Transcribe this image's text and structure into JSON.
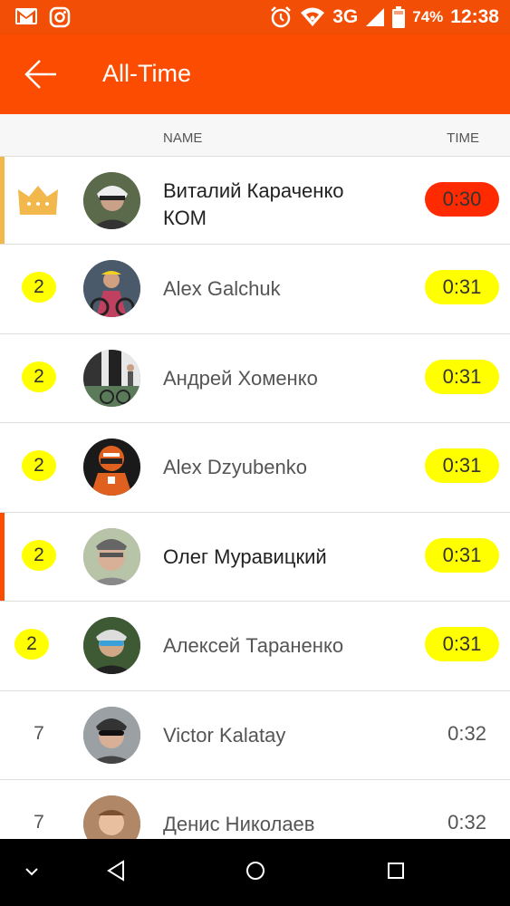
{
  "status_bar": {
    "battery": "74%",
    "network": "3G",
    "time": "12:38"
  },
  "app_bar": {
    "title": "All-Time"
  },
  "table": {
    "headers": {
      "name": "NAME",
      "time": "TIME"
    },
    "rows": [
      {
        "rank": "",
        "name": "Виталий Караченко",
        "sub": "КОМ",
        "time": "0:30",
        "highlight": "crown",
        "time_color": "#ff2a00",
        "rank_color": "",
        "accent": "#f2b84b",
        "avatar_bg": "#5b6a4a"
      },
      {
        "rank": "2",
        "name": "Alex Galchuk",
        "time": "0:31",
        "highlight": "yellow",
        "time_color": "#ffff00",
        "rank_color": "#ffff00",
        "accent": "",
        "avatar_bg": "#4a5a6a"
      },
      {
        "rank": "2",
        "name": "Андрей Хоменко",
        "time": "0:31",
        "highlight": "yellow",
        "time_color": "#ffff00",
        "rank_color": "#ffff00",
        "accent": "",
        "avatar_bg": "#8d8d8d"
      },
      {
        "rank": "2",
        "name": "Alex Dzyubenko",
        "time": "0:31",
        "highlight": "yellow",
        "time_color": "#ffff00",
        "rank_color": "#ffff00",
        "accent": "",
        "avatar_bg": "#3a2a20"
      },
      {
        "rank": "2",
        "name": "Олег Муравицкий",
        "time": "0:31",
        "highlight": "yellow",
        "time_color": "#ffff00",
        "rank_color": "#ffff00",
        "accent": "#fc4c02",
        "avatar_bg": "#9aa38a",
        "bold": true
      },
      {
        "rank": "2",
        "name": "Алексей Тараненко",
        "time": "0:31",
        "highlight": "yellow",
        "time_color": "#ffff00",
        "rank_color": "#ffff00",
        "accent": "",
        "avatar_bg": "#3d5a35"
      },
      {
        "rank": "7",
        "name": "Victor Kalatay",
        "time": "0:32",
        "highlight": "none",
        "time_color": "",
        "rank_color": "",
        "accent": "",
        "avatar_bg": "#7a7f84"
      },
      {
        "rank": "7",
        "name": "Денис Николаев",
        "time": "0:32",
        "highlight": "none",
        "time_color": "",
        "rank_color": "",
        "accent": "",
        "avatar_bg": "#8a6a50"
      }
    ]
  },
  "icons": {
    "status_left": [
      "gmail-icon",
      "instagram-icon"
    ],
    "status_right": [
      "alarm-icon",
      "wifi-icon",
      "signal-icon",
      "battery-icon"
    ],
    "nav": [
      "collapse-icon",
      "back-triangle-icon",
      "home-circle-icon",
      "recents-square-icon"
    ]
  },
  "colors": {
    "brand": "#fc4c02",
    "kom_crown": "#f2b84b"
  }
}
